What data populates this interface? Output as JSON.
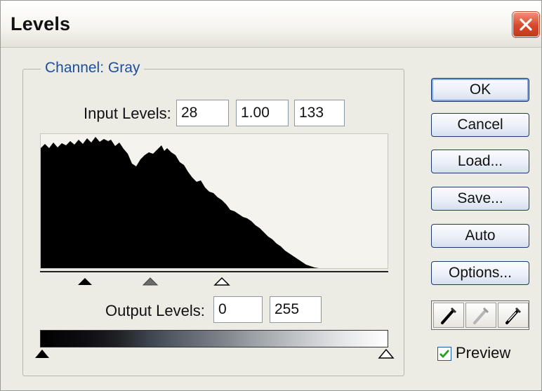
{
  "dialog": {
    "title": "Levels"
  },
  "channel": {
    "label": "Channel:",
    "value": "Gray"
  },
  "input_levels": {
    "label": "Input Levels:",
    "black": "28",
    "gamma": "1.00",
    "white": "133"
  },
  "output_levels": {
    "label": "Output Levels:",
    "black": "0",
    "white": "255"
  },
  "buttons": {
    "ok": "OK",
    "cancel": "Cancel",
    "load": "Load...",
    "save": "Save...",
    "auto": "Auto",
    "options": "Options..."
  },
  "preview": {
    "label": "Preview",
    "checked": true
  },
  "eyedroppers": [
    "black-eyedropper-icon",
    "gray-eyedropper-icon",
    "white-eyedropper-icon"
  ],
  "colors": {
    "accent": "#1d4f9e",
    "close": "#d7482a",
    "button_border": "#1c3a6c"
  }
}
